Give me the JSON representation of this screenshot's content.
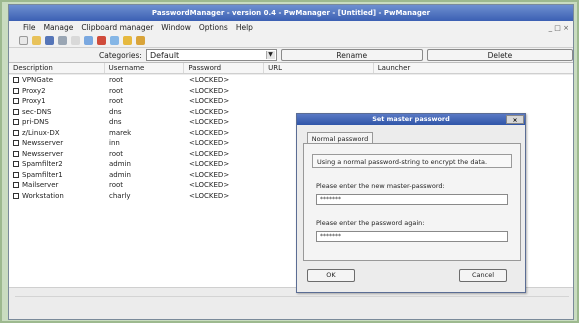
{
  "window": {
    "title": "PasswordManager - version 0.4 - PwManager - [Untitled] - PwManager"
  },
  "menubar": {
    "items": [
      "File",
      "Manage",
      "Clipboard manager",
      "Window",
      "Options",
      "Help"
    ],
    "mdi_controls": "_ □ ×"
  },
  "toolbar": {
    "icons": [
      "new-icon",
      "open-icon",
      "save-icon",
      "print-icon",
      "edit-icon",
      "add-icon",
      "delete-icon",
      "find-icon",
      "lock-icon",
      "key-icon"
    ]
  },
  "category_bar": {
    "label": "Categories:",
    "selected": "Default",
    "rename_label": "Rename",
    "delete_label": "Delete"
  },
  "columns": [
    "Description",
    "Username",
    "Password",
    "URL",
    "Launcher"
  ],
  "rows": [
    {
      "description": "VPNGate",
      "username": "root",
      "password": "<LOCKED>"
    },
    {
      "description": "Proxy2",
      "username": "root",
      "password": "<LOCKED>"
    },
    {
      "description": "Proxy1",
      "username": "root",
      "password": "<LOCKED>"
    },
    {
      "description": "sec-DNS",
      "username": "dns",
      "password": "<LOCKED>"
    },
    {
      "description": "pri-DNS",
      "username": "dns",
      "password": "<LOCKED>"
    },
    {
      "description": "z/Linux-DX",
      "username": "marek",
      "password": "<LOCKED>"
    },
    {
      "description": "Newsserver",
      "username": "inn",
      "password": "<LOCKED>"
    },
    {
      "description": "Newsserver",
      "username": "root",
      "password": "<LOCKED>"
    },
    {
      "description": "Spamfilter2",
      "username": "admin",
      "password": "<LOCKED>"
    },
    {
      "description": "Spamfilter1",
      "username": "admin",
      "password": "<LOCKED>"
    },
    {
      "description": "Mailserver",
      "username": "root",
      "password": "<LOCKED>"
    },
    {
      "description": "Workstation",
      "username": "charly",
      "password": "<LOCKED>"
    }
  ],
  "dialog": {
    "title": "Set master password",
    "close_label": "×",
    "tab_label": "Normal password",
    "info_text": "Using a normal password-string to encrypt the data.",
    "label_new": "Please enter the new master-password:",
    "value_new": "*******",
    "label_again": "Please enter the password again:",
    "value_again": "*******",
    "ok_label": "OK",
    "cancel_label": "Cancel"
  },
  "colors": {
    "titlebar": "#3b5fb3",
    "outer_frame": "#c9dcc0"
  }
}
